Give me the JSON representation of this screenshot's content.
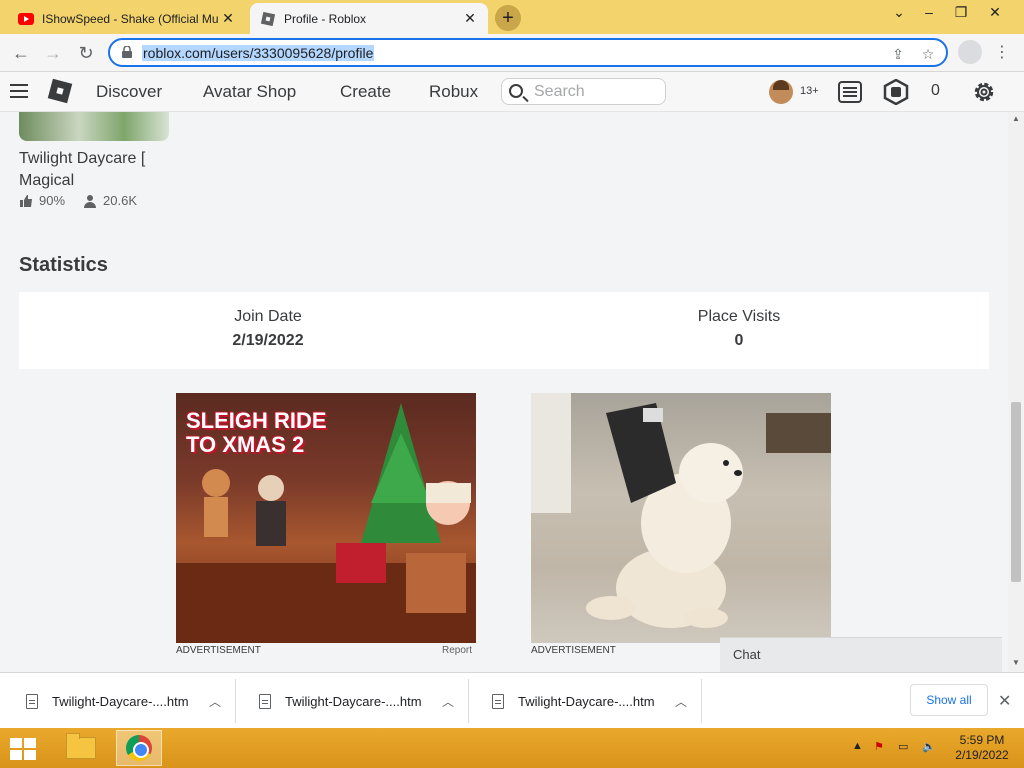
{
  "browser": {
    "tabs": [
      {
        "title": "IShowSpeed - Shake (Official Mu",
        "favicon": "youtube-icon"
      },
      {
        "title": "Profile - Roblox",
        "favicon": "roblox-icon"
      }
    ],
    "url": "roblox.com/users/3330095628/profile"
  },
  "header": {
    "nav": [
      "Discover",
      "Avatar Shop",
      "Create",
      "Robux"
    ],
    "search_placeholder": "Search",
    "age_badge": "13+",
    "robux_count": "0"
  },
  "game": {
    "name": "Twilight Daycare [ Magical",
    "rating": "90%",
    "players": "20.6K"
  },
  "statistics": {
    "heading": "Statistics",
    "join_date_label": "Join Date",
    "join_date_value": "2/19/2022",
    "place_visits_label": "Place Visits",
    "place_visits_value": "0"
  },
  "ads": {
    "left_caption": "ADVERTISEMENT",
    "left_report": "Report",
    "left_title_1": "SLEIGH RIDE",
    "left_title_2": "TO XMAS 2",
    "right_caption": "ADVERTISEMENT"
  },
  "chat": {
    "label": "Chat"
  },
  "downloads": {
    "items": [
      "Twilight-Daycare-....htm",
      "Twilight-Daycare-....htm",
      "Twilight-Daycare-....htm"
    ],
    "show_all": "Show all"
  },
  "taskbar": {
    "time": "5:59 PM",
    "date": "2/19/2022"
  },
  "colors": {
    "accent": "#1a73e8",
    "taskbar": "#e3a11a",
    "text": "#393b3d"
  }
}
